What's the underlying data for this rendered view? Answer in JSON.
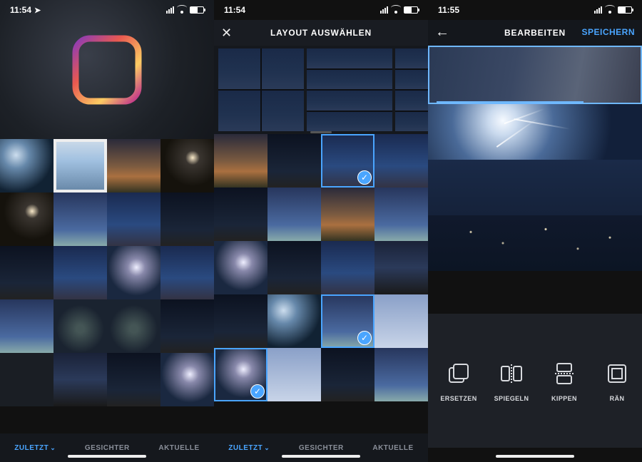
{
  "screen1": {
    "time": "11:54",
    "tabs": [
      {
        "id": "zuletzt",
        "label": "ZULETZT",
        "active": true,
        "hasChevron": true
      },
      {
        "id": "gesichter",
        "label": "GESICHTER",
        "active": false,
        "hasChevron": false
      },
      {
        "id": "aktuelle",
        "label": "AKTUELLE",
        "active": false,
        "hasChevron": false
      }
    ]
  },
  "screen2": {
    "time": "11:54",
    "title": "LAYOUT AUSWÄHLEN",
    "tabs": [
      {
        "id": "zuletzt",
        "label": "ZULETZT",
        "active": true,
        "hasChevron": true
      },
      {
        "id": "gesichter",
        "label": "GESICHTER",
        "active": false,
        "hasChevron": false
      },
      {
        "id": "aktuelle",
        "label": "AKTUELLE",
        "active": false,
        "hasChevron": false
      }
    ]
  },
  "screen3": {
    "time": "11:55",
    "title": "BEARBEITEN",
    "saveLabel": "SPEICHERN",
    "tools": [
      {
        "id": "ersetzen",
        "label": "ERSETZEN"
      },
      {
        "id": "spiegeln",
        "label": "SPIEGELN"
      },
      {
        "id": "kippen",
        "label": "KIPPEN"
      },
      {
        "id": "raender",
        "label": "RÄN"
      }
    ]
  },
  "colors": {
    "accent": "#4aa5ff",
    "selection": "#6fb8ff"
  }
}
